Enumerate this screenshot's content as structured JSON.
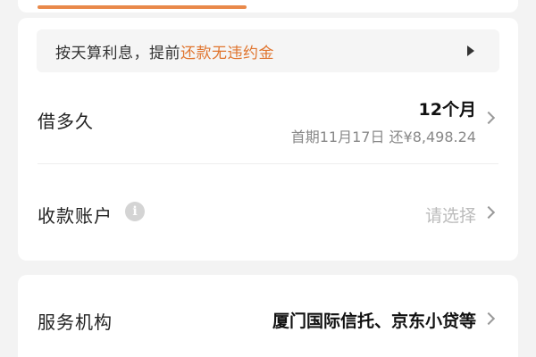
{
  "notice": {
    "text_plain": "按天算利息，提前",
    "text_highlight": "还款无违约金",
    "play_icon": "play-triangle-icon"
  },
  "loan_term": {
    "label": "借多久",
    "value": "12个月",
    "sub": "首期11月17日 还¥8,498.24"
  },
  "receive_account": {
    "label": "收款账户",
    "info_icon": "i",
    "placeholder": "请选择"
  },
  "service": {
    "label": "服务机构",
    "value": "厦门国际信托、京东小贷等"
  },
  "colors": {
    "accent": "#e9894a",
    "highlight_text": "#e0752f",
    "background": "#f3f3f3"
  }
}
